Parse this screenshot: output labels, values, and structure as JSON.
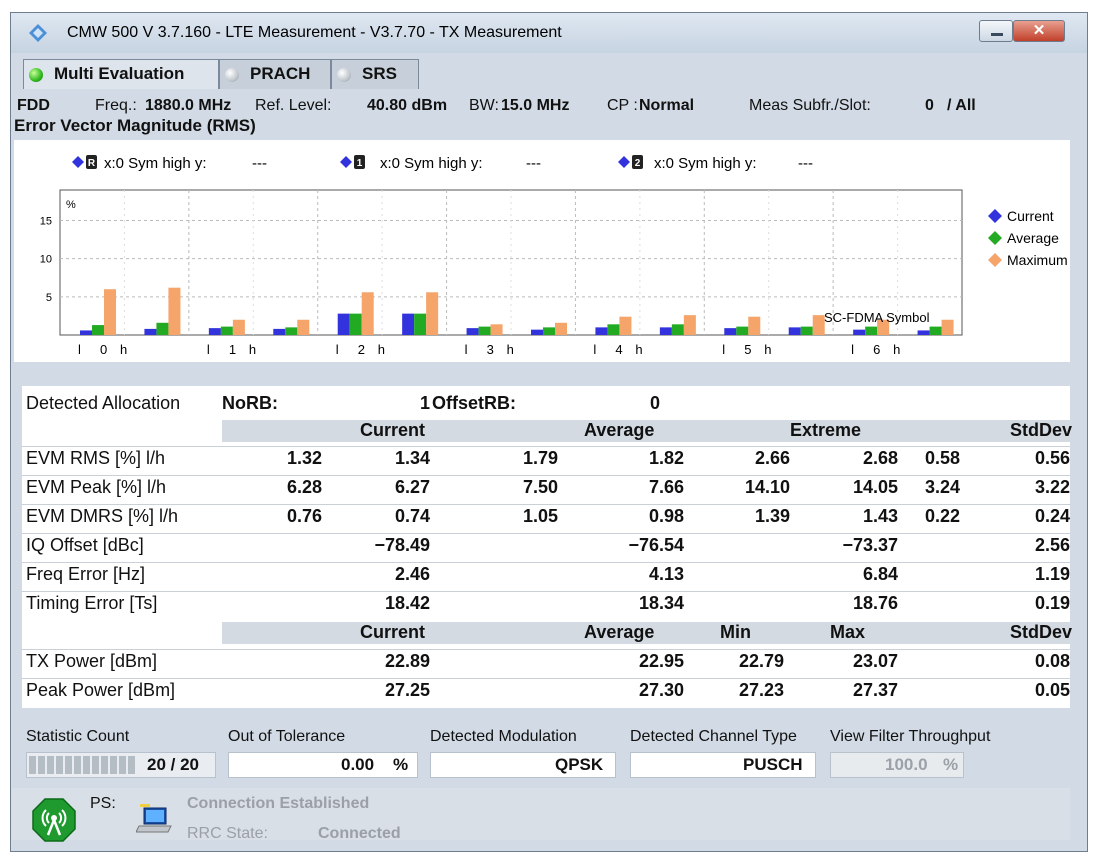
{
  "window": {
    "title": "CMW 500 V 3.7.160 - LTE Measurement  - V3.7.70 - TX Measurement",
    "close_glyph": "✕"
  },
  "tabs": [
    {
      "label": "Multi Evaluation",
      "state": "on"
    },
    {
      "label": "PRACH",
      "state": "off"
    },
    {
      "label": "SRS",
      "state": "off"
    }
  ],
  "info": {
    "duplex": "FDD",
    "freq_label": "Freq.:",
    "freq_value": "1880.0 MHz",
    "ref_label": "Ref. Level:",
    "ref_value": "40.80 dBm",
    "bw_label": "BW:",
    "bw_value": "15.0 MHz",
    "cp_label": "CP :",
    "cp_value": "Normal",
    "subfr_label": "Meas Subfr./Slot:",
    "subfr_value": "0",
    "slot_value": "/ All"
  },
  "section_title": "Error Vector Magnitude (RMS)",
  "markers": [
    {
      "badge": "R",
      "text": "x:0 Sym high y:",
      "value": "---"
    },
    {
      "badge": "1",
      "text": "x:0 Sym high y:",
      "value": "---"
    },
    {
      "badge": "2",
      "text": "x:0 Sym high y:",
      "value": "---"
    }
  ],
  "colors": {
    "current": "#3333dd",
    "average": "#22aa22",
    "maximum": "#f5a46a"
  },
  "chart_data": {
    "type": "bar",
    "ylabel": "%",
    "xlabel": "SC-FDMA Symbol",
    "ylim": [
      0,
      19
    ],
    "yticks": [
      5,
      10,
      15
    ],
    "groups": [
      "0",
      "1",
      "2",
      "3",
      "4",
      "5",
      "6"
    ],
    "sub_labels": [
      "l",
      "h"
    ],
    "series": [
      {
        "name": "Current",
        "values": [
          [
            0.6,
            0.8
          ],
          [
            0.9,
            0.8
          ],
          [
            2.8,
            2.8
          ],
          [
            0.9,
            0.7
          ],
          [
            1.0,
            1.0
          ],
          [
            0.9,
            1.0
          ],
          [
            0.7,
            0.6
          ]
        ]
      },
      {
        "name": "Average",
        "values": [
          [
            1.3,
            1.6
          ],
          [
            1.1,
            1.0
          ],
          [
            2.8,
            2.8
          ],
          [
            1.1,
            1.0
          ],
          [
            1.4,
            1.4
          ],
          [
            1.1,
            1.1
          ],
          [
            1.1,
            1.1
          ]
        ]
      },
      {
        "name": "Maximum",
        "values": [
          [
            6.0,
            6.2
          ],
          [
            2.0,
            2.0
          ],
          [
            5.6,
            5.6
          ],
          [
            1.4,
            1.6
          ],
          [
            2.4,
            2.6
          ],
          [
            2.4,
            2.6
          ],
          [
            2.0,
            2.0
          ]
        ]
      }
    ],
    "legend_position": "right"
  },
  "results": {
    "allocation_label": "Detected Allocation",
    "norb_label": "NoRB:",
    "norb_value": "1",
    "offsetrb_label": "OffsetRB:",
    "offsetrb_value": "0",
    "header1": {
      "current": "Current",
      "average": "Average",
      "extreme": "Extreme",
      "stddev": "StdDev"
    },
    "rows1": [
      {
        "label": "EVM RMS [%] l/h",
        "vals": [
          "1.32",
          "1.34",
          "1.79",
          "1.82",
          "2.66",
          "2.68",
          "0.58",
          "0.56"
        ]
      },
      {
        "label": "EVM Peak [%] l/h",
        "vals": [
          "6.28",
          "6.27",
          "7.50",
          "7.66",
          "14.10",
          "14.05",
          "3.24",
          "3.22"
        ]
      },
      {
        "label": "EVM DMRS [%] l/h",
        "vals": [
          "0.76",
          "0.74",
          "1.05",
          "0.98",
          "1.39",
          "1.43",
          "0.22",
          "0.24"
        ]
      }
    ],
    "rows2": [
      {
        "label": "IQ Offset [dBc]",
        "vals": [
          "−78.49",
          "−76.54",
          "−73.37",
          "2.56"
        ]
      },
      {
        "label": "Freq Error [Hz]",
        "vals": [
          "2.46",
          "4.13",
          "6.84",
          "1.19"
        ]
      },
      {
        "label": "Timing Error [Ts]",
        "vals": [
          "18.42",
          "18.34",
          "18.76",
          "0.19"
        ]
      }
    ],
    "header2": {
      "current": "Current",
      "average": "Average",
      "min": "Min",
      "max": "Max",
      "stddev": "StdDev"
    },
    "rows3": [
      {
        "label": "TX Power [dBm]",
        "vals": [
          "22.89",
          "22.95",
          "22.79",
          "23.07",
          "0.08"
        ]
      },
      {
        "label": "Peak Power [dBm]",
        "vals": [
          "27.25",
          "27.30",
          "27.23",
          "27.37",
          "0.05"
        ]
      }
    ]
  },
  "bottom": {
    "stat_label": "Statistic Count",
    "stat_value": "20 / 20",
    "stat_progress": 1.0,
    "oot_label": "Out of Tolerance",
    "oot_value": "0.00",
    "oot_unit": "%",
    "mod_label": "Detected Modulation",
    "mod_value": "QPSK",
    "chan_label": "Detected Channel Type",
    "chan_value": "PUSCH",
    "filter_label": "View Filter Throughput",
    "filter_value": "100.0",
    "filter_unit": "%"
  },
  "status": {
    "ps_label": "PS:",
    "connection": "Connection Established",
    "rrc_label": "RRC State:",
    "rrc_value": "Connected"
  }
}
